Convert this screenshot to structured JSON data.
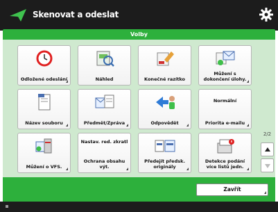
{
  "header": {
    "title": "Skenovat a odeslat",
    "logo_icon": "send-arrow-icon",
    "settings_icon": "gear-icon"
  },
  "section": {
    "label": "Volby"
  },
  "tiles": [
    {
      "label": "Odložené odeslání",
      "icon": "clock-icon",
      "has_submenu": true
    },
    {
      "label": "Náhled",
      "icon": "preview-magnifier-icon",
      "has_submenu": false
    },
    {
      "label": "Konečné razítko",
      "icon": "stamp-icon",
      "has_submenu": false
    },
    {
      "label": "Můžení s dokončení úlohy.",
      "icon": "notify-job-icon",
      "has_submenu": true
    },
    {
      "label": "Název souboru",
      "icon": "file-name-icon",
      "has_submenu": true
    },
    {
      "label": "Předmět/Zpráva",
      "icon": "subject-message-icon",
      "has_submenu": true
    },
    {
      "label": "Odpovědět",
      "icon": "reply-to-icon",
      "has_submenu": true
    },
    {
      "label": "Priorita e-mailu",
      "icon": "",
      "title": "Normální",
      "has_submenu": true
    },
    {
      "label": "Můžení o VFS.",
      "icon": "notify-vfs-icon",
      "has_submenu": true
    },
    {
      "label": "Ochrana obsahu výt.",
      "icon": "",
      "title": "Nastav. red. zkratl",
      "has_submenu": true
    },
    {
      "label": "Předejít předsk. originály",
      "icon": "originals-icon",
      "has_submenu": true
    },
    {
      "label": "Detekce podání více listů jedn.",
      "icon": "multifeed-icon",
      "has_submenu": true
    }
  ],
  "pagination": {
    "count": "2/2"
  },
  "scroll": {
    "up_icon": "arrow-up-icon",
    "down_icon": "arrow-down-icon"
  },
  "footer": {
    "close_label": "Zavřít"
  }
}
